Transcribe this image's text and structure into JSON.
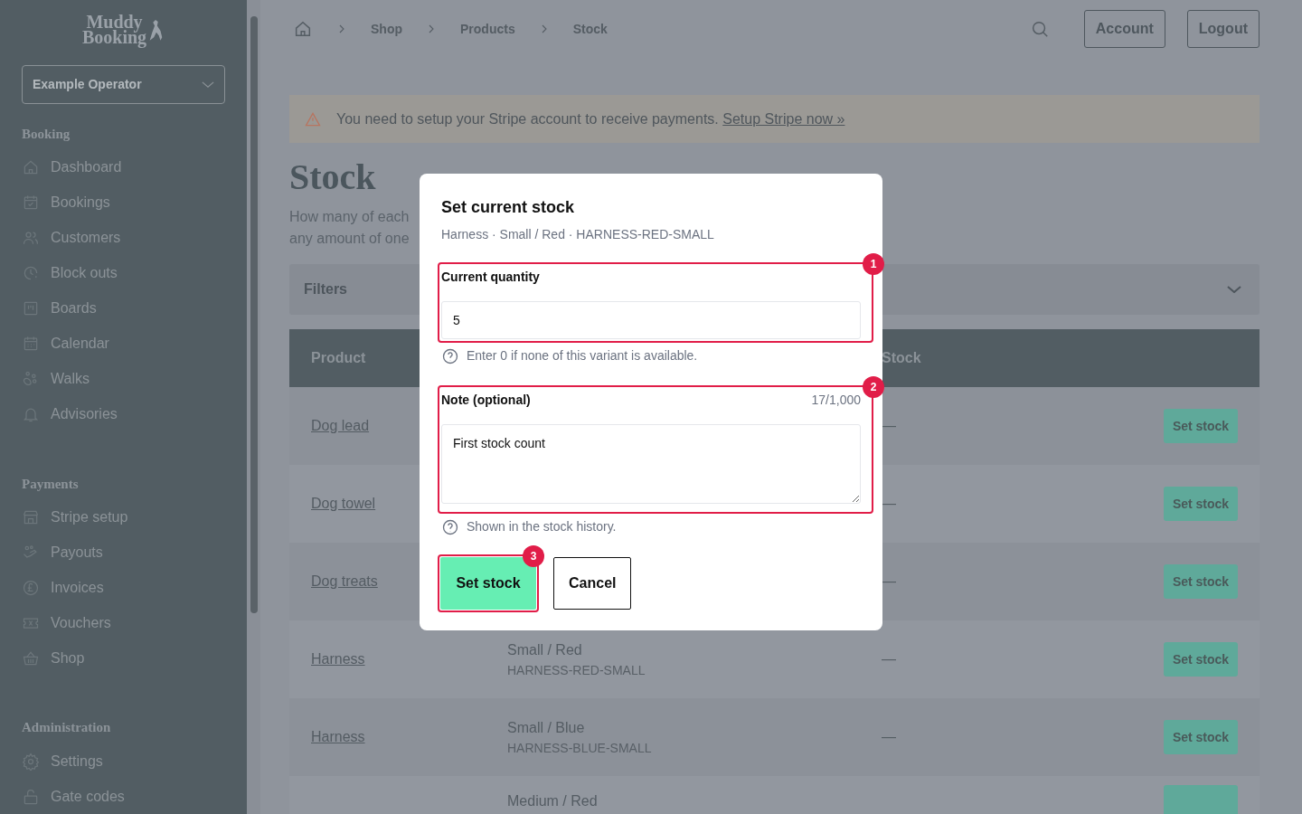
{
  "sidebar": {
    "logo": [
      "Muddy",
      "Booking"
    ],
    "operator_select": {
      "value": "Example Operator"
    },
    "sections": [
      {
        "heading": "Booking",
        "items": [
          {
            "label": "Dashboard"
          },
          {
            "label": "Bookings"
          },
          {
            "label": "Customers"
          },
          {
            "label": "Block outs"
          },
          {
            "label": "Boards"
          },
          {
            "label": "Calendar"
          },
          {
            "label": "Walks"
          },
          {
            "label": "Advisories"
          }
        ]
      },
      {
        "heading": "Payments",
        "items": [
          {
            "label": "Stripe setup"
          },
          {
            "label": "Payouts"
          },
          {
            "label": "Invoices"
          },
          {
            "label": "Vouchers"
          },
          {
            "label": "Shop"
          }
        ]
      },
      {
        "heading": "Administration",
        "items": [
          {
            "label": "Settings"
          },
          {
            "label": "Gate codes"
          }
        ]
      }
    ]
  },
  "breadcrumbs": [
    "Shop",
    "Products",
    "Stock"
  ],
  "header_buttons": [
    "Account",
    "Logout"
  ],
  "alert": {
    "text": "You need to setup your Stripe account to receive payments.",
    "link": "Setup Stripe now »"
  },
  "page": {
    "title": "Stock",
    "description_lines": [
      "How many of each",
      "any amount of one"
    ]
  },
  "filters": {
    "label": "Filters",
    "expanded": false
  },
  "table": {
    "columns": [
      "Product",
      "Stock"
    ],
    "rows": [
      {
        "product": "Dog lead",
        "stock": "—",
        "action": "Set stock"
      },
      {
        "product": "Dog towel",
        "stock": "—",
        "action": "Set stock"
      },
      {
        "product": "Dog treats",
        "stock": "—",
        "action": "Set stock"
      },
      {
        "product": "Harness",
        "variant": "Small / Red",
        "sku": "HARNESS-RED-SMALL",
        "stock": "—",
        "action": "Set stock"
      },
      {
        "product": "Harness",
        "variant": "Small / Blue",
        "sku": "HARNESS-BLUE-SMALL",
        "stock": "—",
        "action": "Set stock"
      },
      {
        "variant": "Medium / Red"
      }
    ]
  },
  "modal": {
    "title": "Set current stock",
    "subtitle": "Harness · Small / Red · HARNESS-RED-SMALL",
    "quantity": {
      "label": "Current quantity",
      "value": "5",
      "help": "Enter 0 if none of this variant is available.",
      "marker": "1"
    },
    "note": {
      "label": "Note (optional)",
      "counter": "17/1,000",
      "value": "First stock count",
      "help": "Shown in the stock history.",
      "marker": "2"
    },
    "buttons": [
      {
        "label": "Set stock",
        "kind": "primary",
        "marker": "3"
      },
      {
        "label": "Cancel",
        "kind": "secondary"
      }
    ]
  }
}
